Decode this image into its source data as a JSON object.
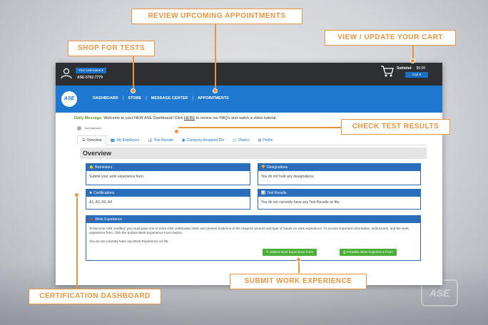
{
  "topbar": {
    "user_name": "Your Username",
    "user_id": "ASE-5762-7779",
    "subtotal_label": "Subtotal:",
    "subtotal_value": "$0.00",
    "cart_button": "Cart ▾"
  },
  "logo_text": "ASE",
  "nav": {
    "items": [
      "DASHBOARD",
      "STORE",
      "MESSAGE CENTER",
      "APPOINTMENTS"
    ],
    "separator": "|"
  },
  "daily_message": {
    "label": "Daily Message:",
    "text_before": " Welcome to your NEW ASE Dashboard! Click ",
    "link": "HERE",
    "text_after": " to review our FAQ's and watch a video tutorial."
  },
  "profile_name": "Your Username",
  "tabs": [
    {
      "icon": "☰",
      "label": "Overview"
    },
    {
      "icon": "👥",
      "label": "My Employers"
    },
    {
      "icon": "📊",
      "label": "Test Results"
    },
    {
      "icon": "▣",
      "label": "Company-Assigned IDs"
    },
    {
      "icon": "🛒",
      "label": "Orders"
    },
    {
      "icon": "▤",
      "label": "Profile"
    }
  ],
  "overview_title": "Overview",
  "panels": {
    "reminders": {
      "icon": "🔔",
      "title": "Reminders",
      "body": "Submit your work experience form."
    },
    "designations": {
      "icon": "🏆",
      "title": "Designations",
      "body": "You do not hold any designations."
    },
    "certifications": {
      "icon": "✸",
      "title": "Certifications",
      "body": "A1, A2, A3, A4"
    },
    "test_results": {
      "icon": "📊",
      "title": "Test Results",
      "body": "You do not currently have any Test Results on file."
    },
    "work_experience": {
      "icon": "🚗",
      "title": "Work Experience",
      "body1": "To become ASE certified, you must pass one or more ASE certification tests and present evidence of the required amount and type of hands-on work experience. To access important information, instructions, and the work experience form, click the Submit Work Experience Form button.",
      "body2": "You do not currently have any Work Experience on file.",
      "submit_button": "✎ Submit Work Experience Form",
      "print_button": "⎙ Printable Work Experience Form"
    }
  },
  "callouts": {
    "review": "REVIEW UPCOMING APPOINTMENTS",
    "cart": "VIEW / UPDATE YOUR CART",
    "shop": "SHOP FOR TESTS",
    "check": "CHECK TEST RESULTS",
    "certification": "CERTIFICATION DASHBOARD",
    "submit": "SUBMIT WORK EXPERIENCE"
  },
  "colors": {
    "accent_orange": "#e9953f",
    "nav_blue": "#1f78cf",
    "panel_blue": "#2a6ebb",
    "button_green": "#4caf3a",
    "topbar_dark": "#2d2f33"
  }
}
